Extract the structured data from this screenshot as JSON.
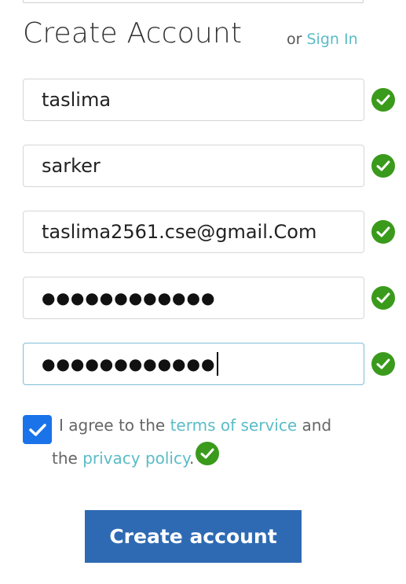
{
  "header": {
    "title": "Create Account",
    "or_text": "or",
    "signin_label": "Sign In"
  },
  "form": {
    "first_name": {
      "value": "taslima",
      "valid": true
    },
    "last_name": {
      "value": "sarker",
      "valid": true
    },
    "email": {
      "value": "taslima2561.cse@gmail.Com",
      "valid": true
    },
    "password": {
      "value": "●●●●●●●●●●●●",
      "valid": true
    },
    "confirm_password": {
      "value": "●●●●●●●●●●●●",
      "valid": true,
      "focused": true
    }
  },
  "agreement": {
    "checked": true,
    "text_prefix": "I agree to the",
    "terms_label": "terms of service",
    "text_and": "and",
    "text_the": "the",
    "privacy_label": "privacy policy",
    "text_period": ".",
    "valid": true
  },
  "submit": {
    "label": "Create account"
  },
  "colors": {
    "accent_link": "#5bbcc6",
    "valid_green": "#3a9a1c",
    "checkbox_blue": "#1a73e8",
    "button_blue": "#2e6ab3"
  }
}
